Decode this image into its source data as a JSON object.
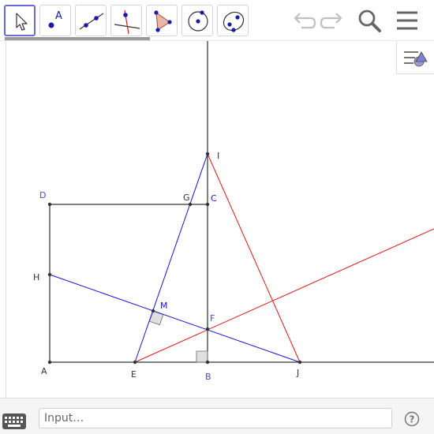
{
  "toolbar": {
    "tools": [
      {
        "name": "move-tool",
        "label": ""
      },
      {
        "name": "point-tool",
        "label": "A"
      },
      {
        "name": "line-tool",
        "label": ""
      },
      {
        "name": "perpendicular-tool",
        "label": ""
      },
      {
        "name": "polygon-tool",
        "label": ""
      },
      {
        "name": "circle-tool",
        "label": ""
      },
      {
        "name": "ellipse-tool",
        "label": ""
      }
    ],
    "actions": [
      "undo-icon",
      "redo-icon",
      "search-icon",
      "menu-icon"
    ],
    "style_bar_icon": "style-bar-toggle-icon"
  },
  "graphics": {
    "points": {
      "A": "A",
      "B": "B",
      "C": "C",
      "D": "D",
      "E": "E",
      "F": "F",
      "G": "G",
      "H": "H",
      "I": "I",
      "J": "J",
      "M": "M"
    },
    "colors": {
      "blue_lines": "#1515d6",
      "red_lines": "#e01919",
      "black_lines": "#000000",
      "label_blue": "#4a4ad6",
      "right_angle_fill": "#cccccc"
    }
  },
  "input_bar": {
    "placeholder": "Input…",
    "value": "",
    "keyboard_icon": "keyboard-icon",
    "help_icon": "help-icon"
  }
}
